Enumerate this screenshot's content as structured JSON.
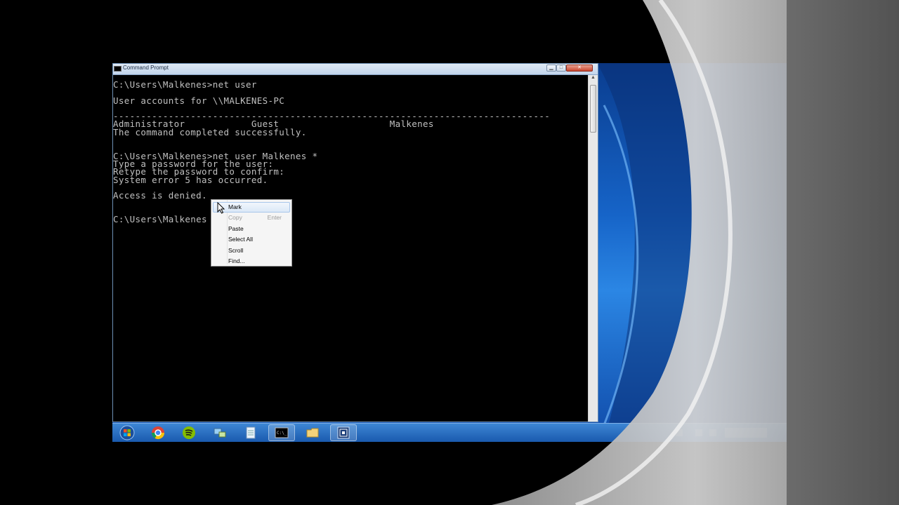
{
  "window": {
    "title": "Command Prompt",
    "buttons": {
      "minimize": "▁",
      "maximize": "□",
      "close": "✕"
    }
  },
  "console": {
    "lines": [
      "C:\\Users\\Malkenes>net user",
      "",
      "User accounts for \\\\MALKENES-PC",
      "",
      "-------------------------------------------------------------------------------",
      "Administrator            Guest                    Malkenes",
      "The command completed successfully.",
      "",
      "",
      "C:\\Users\\Malkenes>net user Malkenes *",
      "Type a password for the user:",
      "Retype the password to confirm:",
      "System error 5 has occurred.",
      "",
      "Access is denied.",
      "",
      "",
      "C:\\Users\\Malkenes"
    ]
  },
  "context_menu": {
    "items": [
      {
        "label": "Mark",
        "shortcut": "",
        "disabled": false,
        "hover": true
      },
      {
        "label": "Copy",
        "shortcut": "Enter",
        "disabled": true,
        "hover": false
      },
      {
        "label": "Paste",
        "shortcut": "",
        "disabled": false,
        "hover": false
      },
      {
        "label": "Select All",
        "shortcut": "",
        "disabled": false,
        "hover": false
      },
      {
        "label": "Scroll",
        "shortcut": "",
        "disabled": false,
        "hover": false
      },
      {
        "label": "Find...",
        "shortcut": "",
        "disabled": false,
        "hover": false
      }
    ]
  },
  "taskbar": {
    "buttons": [
      {
        "name": "start-orb-icon",
        "active": false
      },
      {
        "name": "chrome-icon",
        "active": false
      },
      {
        "name": "spotify-icon",
        "active": false
      },
      {
        "name": "network-app-icon",
        "active": false
      },
      {
        "name": "notepad-icon",
        "active": false
      },
      {
        "name": "command-prompt-icon",
        "active": true
      },
      {
        "name": "file-explorer-icon",
        "active": false
      },
      {
        "name": "remote-desktop-icon",
        "active": true
      }
    ]
  },
  "colors": {
    "console_text": "#c0c0c0",
    "console_bg": "#000000",
    "taskbar": "#2a6fc2",
    "menu_bg": "#f5f5f5"
  }
}
